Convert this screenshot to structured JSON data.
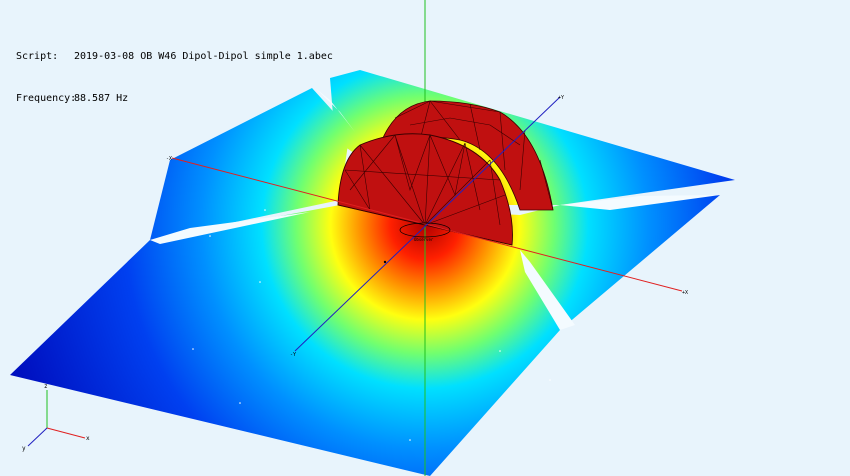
{
  "info": {
    "script_label": "Script:",
    "script_value": "2019-03-08 OB W46 Dipol-Dipol simple 1.abec",
    "frequency_label": "Frequency:",
    "frequency_value": "88.587 Hz"
  },
  "axes": {
    "x_neg_label": "-X",
    "x_pos_label": "+X",
    "y_pos_label": "+Y",
    "y_neg_label": "-Y",
    "observer_label": "Observer"
  },
  "colors": {
    "background": "#e8f4fc",
    "mesh_red": "#c01010",
    "mesh_edge": "#3a0000",
    "x_axis": "#e02020",
    "y_axis": "#2020c0",
    "z_axis": "#20c020"
  },
  "gizmo": {
    "x_label": "x",
    "y_label": "y",
    "z_label": "z"
  }
}
